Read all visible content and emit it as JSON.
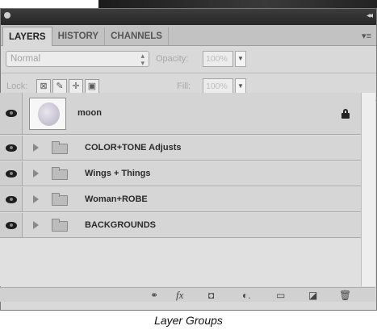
{
  "panel": {
    "tabs": [
      {
        "label": "LAYERS",
        "active": true
      },
      {
        "label": "HISTORY",
        "active": false
      },
      {
        "label": "CHANNELS",
        "active": false
      }
    ],
    "menu_icon": "panel-menu-icon"
  },
  "options": {
    "blend_mode": "Normal",
    "opacity_label": "Opacity:",
    "opacity_value": "100%",
    "lock_label": "Lock:",
    "fill_label": "Fill:",
    "fill_value": "100%"
  },
  "layers": [
    {
      "name": "moon",
      "type": "layer",
      "visible": true,
      "locked": true
    },
    {
      "name": "COLOR+TONE Adjusts",
      "type": "group",
      "visible": true
    },
    {
      "name": "Wings + Things",
      "type": "group",
      "visible": true
    },
    {
      "name": "Woman+ROBE",
      "type": "group",
      "visible": true
    },
    {
      "name": "BACKGROUNDS",
      "type": "group",
      "visible": true
    }
  ],
  "bottom_tools": [
    "link-layers-icon",
    "fx-icon",
    "add-mask-icon",
    "adjustment-layer-icon",
    "new-group-icon",
    "new-layer-icon",
    "trash-icon"
  ],
  "caption": "Layer Groups"
}
